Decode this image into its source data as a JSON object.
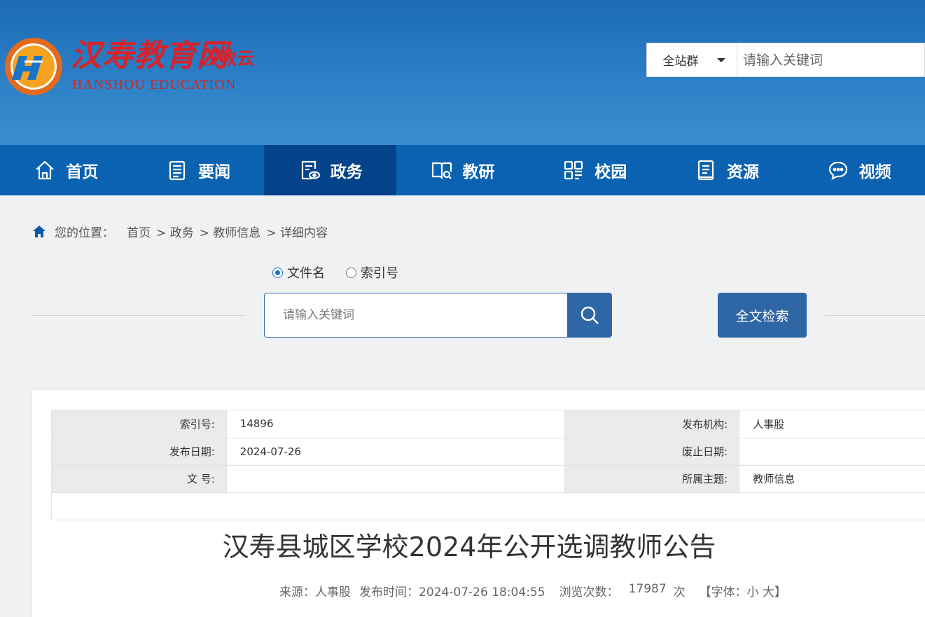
{
  "header": {
    "logo_cn": "汉寿教育网",
    "logo_cloud": "汉教云",
    "logo_en": "HANSHOU EDUCATION",
    "scope_select": "全站群",
    "search_placeholder": "请输入关键词"
  },
  "nav": {
    "items": [
      {
        "label": "首页",
        "icon": "home-icon"
      },
      {
        "label": "要闻",
        "icon": "news-icon"
      },
      {
        "label": "政务",
        "icon": "document-eye-icon"
      },
      {
        "label": "教研",
        "icon": "book-search-icon"
      },
      {
        "label": "校园",
        "icon": "grid-icon"
      },
      {
        "label": "资源",
        "icon": "folder-doc-icon"
      },
      {
        "label": "视频",
        "icon": "chat-bubble-icon"
      }
    ],
    "active_index": 2,
    "color": "#0a62b1",
    "active_color": "#04438a"
  },
  "breadcrumb": {
    "lead": "您的位置：",
    "items": [
      "首页",
      "> 政务",
      "> 教师信息",
      "> 详细内容"
    ]
  },
  "search": {
    "radio_filename": "文件名",
    "radio_index": "索引号",
    "selected": "文件名",
    "placeholder": "请输入关键词",
    "fulltext_label": "全文检索"
  },
  "meta": {
    "rows": [
      {
        "k1": "索引号:",
        "v1": "14896",
        "k2": "发布机构:",
        "v2": "人事股"
      },
      {
        "k1": "发布日期:",
        "v1": "2024-07-26",
        "k2": "废止日期:",
        "v2": ""
      },
      {
        "k1": "文 号:",
        "v1": "",
        "k2": "所属主题:",
        "v2": "教师信息"
      }
    ]
  },
  "article": {
    "title": "汉寿县城区学校2024年公开选调教师公告",
    "source": "来源：人事股",
    "publish_time": "发布时间：2024-07-26 18:04:55",
    "views_label": "浏览次数：",
    "views": "17987",
    "views_unit": "次",
    "font_size": "【字体：小 大】"
  }
}
